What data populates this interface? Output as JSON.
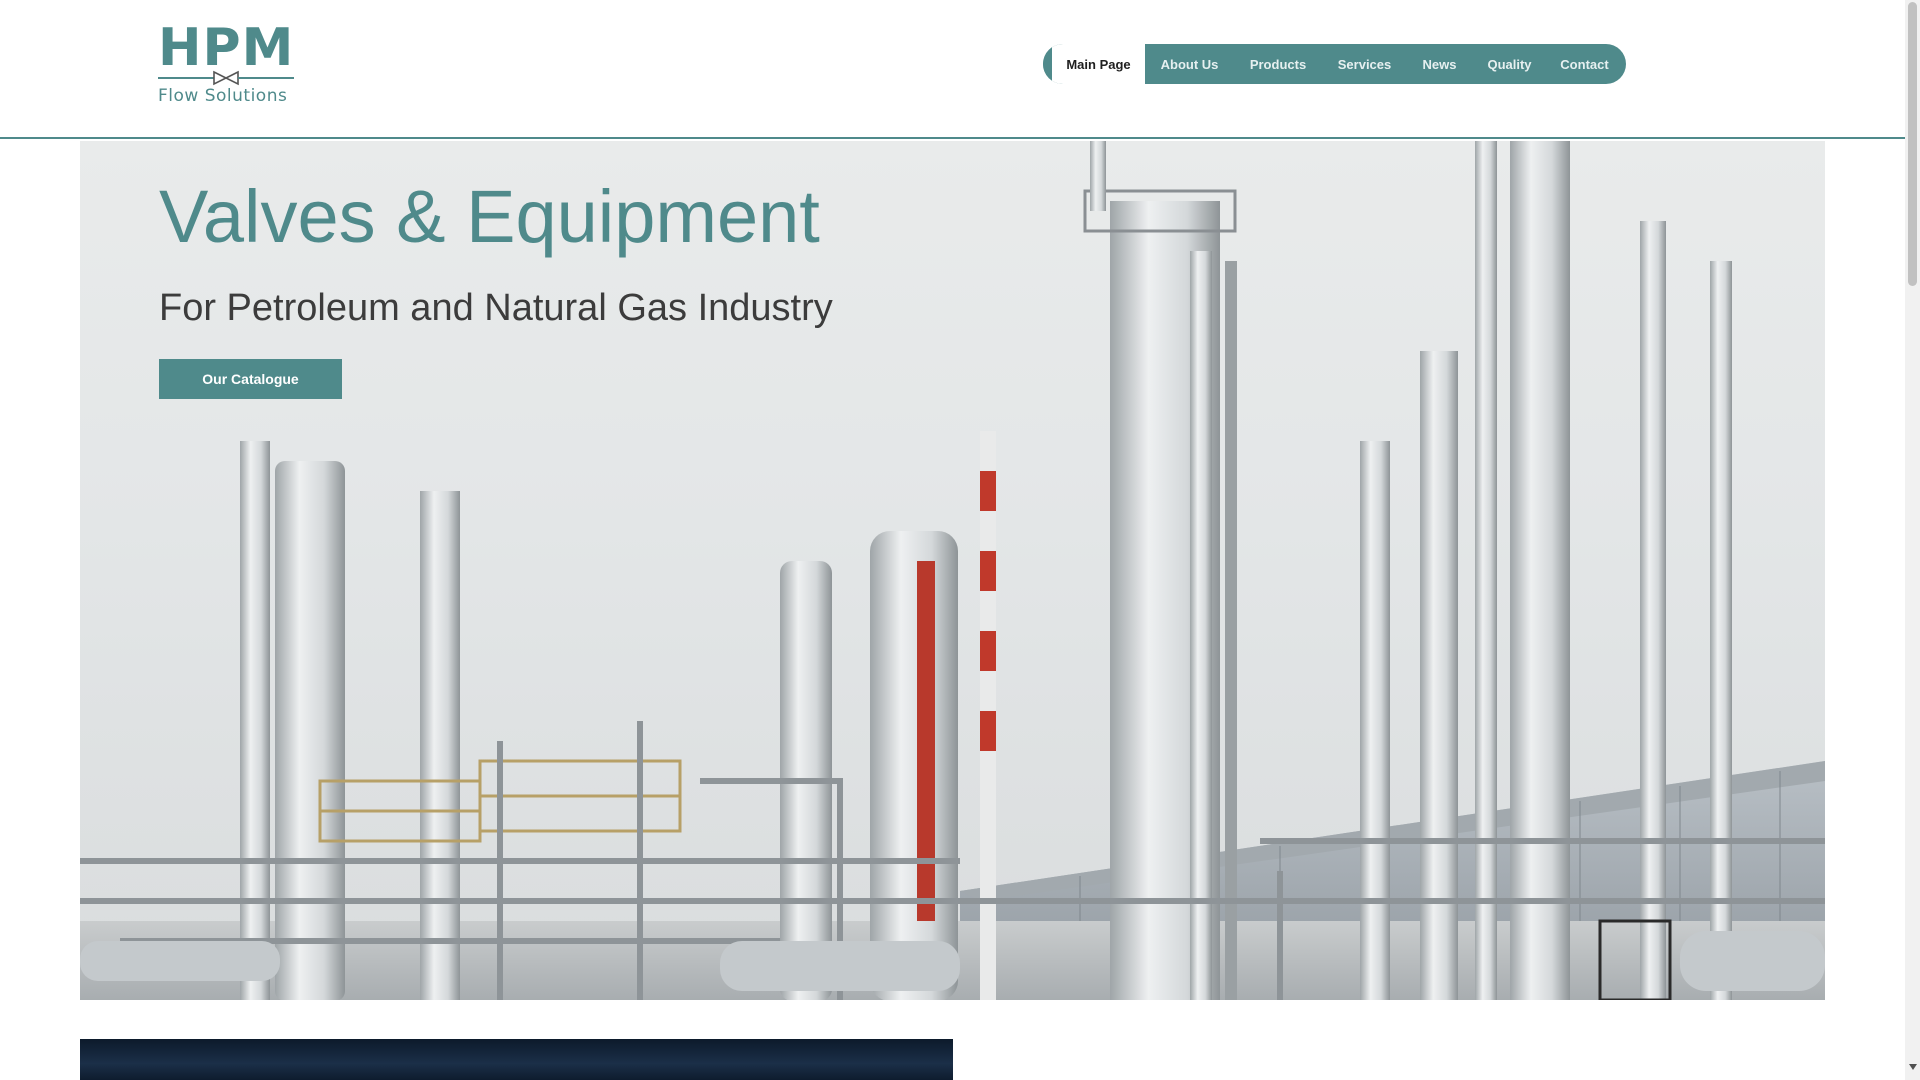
{
  "brand": {
    "logo_text": "HPM",
    "logo_subtext": "Flow Solutions",
    "accent_color": "#4f8a8b"
  },
  "nav": {
    "items": [
      {
        "label": "Main Page",
        "active": true
      },
      {
        "label": "About Us",
        "active": false
      },
      {
        "label": "Products",
        "active": false
      },
      {
        "label": "Services",
        "active": false
      },
      {
        "label": "News",
        "active": false
      },
      {
        "label": "Quality",
        "active": false
      },
      {
        "label": "Contact",
        "active": false
      }
    ]
  },
  "hero": {
    "title": "Valves & Equipment",
    "subtitle": "For Petroleum and Natural Gas Industry",
    "cta_label": "Our Catalogue",
    "background_icon": "industrial-plant-image"
  }
}
